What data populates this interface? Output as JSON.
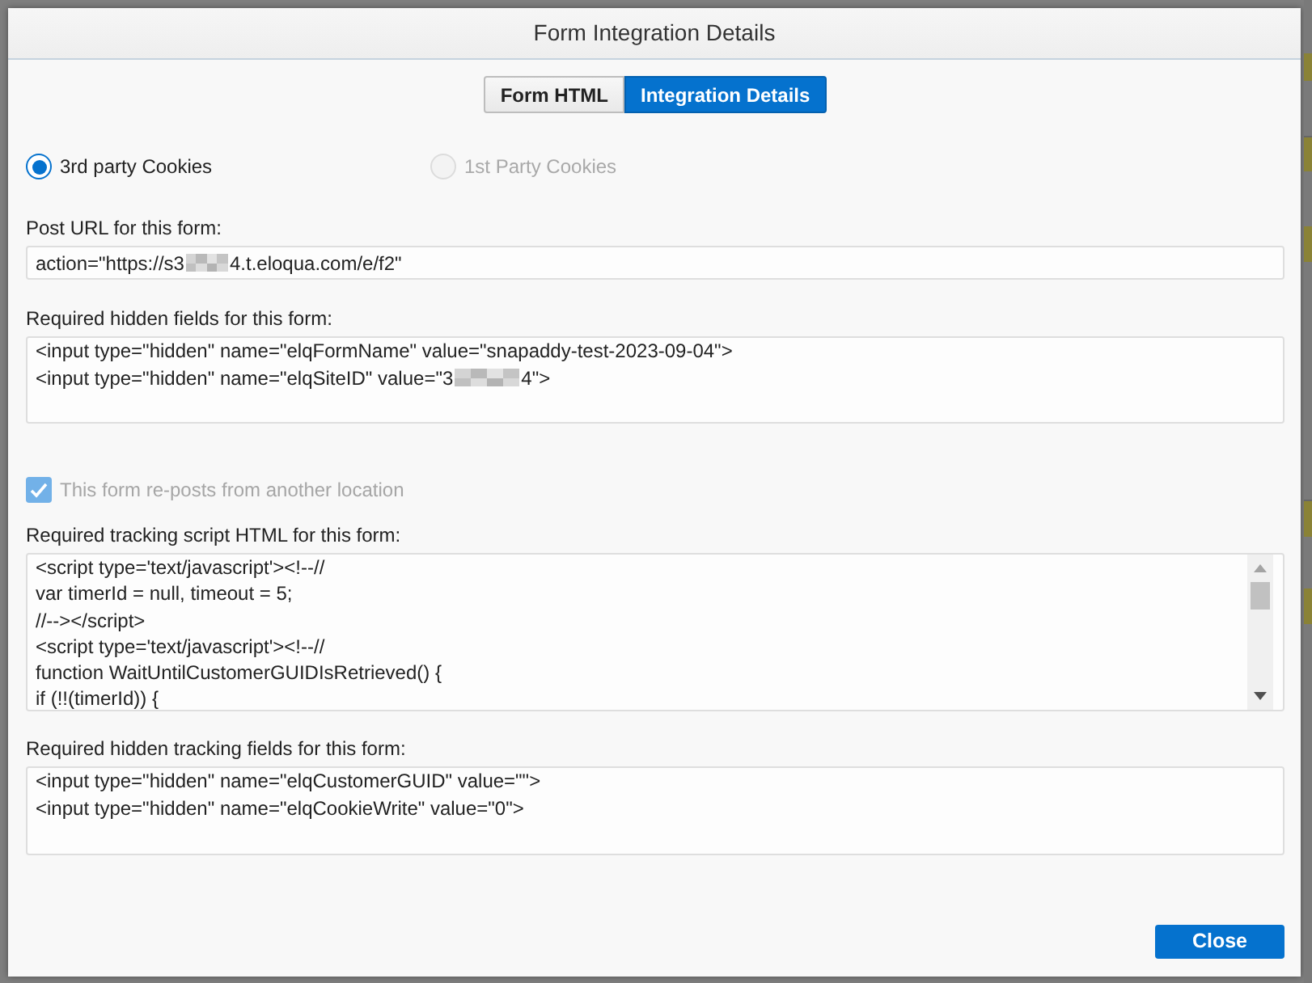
{
  "window": {
    "title": "Form Integration Details"
  },
  "tabs": [
    {
      "label": "Form HTML",
      "selected": false
    },
    {
      "label": "Integration Details",
      "selected": true
    }
  ],
  "cookie_options": [
    {
      "label": "3rd party Cookies",
      "selected": true,
      "disabled": false
    },
    {
      "label": "1st Party Cookies",
      "selected": false,
      "disabled": true
    }
  ],
  "post_url": {
    "label": "Post URL for this form:",
    "value": [
      {
        "kind": "text",
        "text": "action=\"https://s3"
      },
      {
        "kind": "redacted"
      },
      {
        "kind": "text",
        "text": "4.t.eloqua.com/e/f2\""
      }
    ]
  },
  "hidden_fields": {
    "label": "Required hidden fields for this form:",
    "lines": [
      [
        {
          "kind": "text",
          "text": "<input type=\"hidden\" name=\"elqFormName\" value=\"snapaddy-test-2023-09-04\">"
        }
      ],
      [
        {
          "kind": "text",
          "text": "<input type=\"hidden\" name=\"elqSiteID\" value=\"3"
        },
        {
          "kind": "redacted"
        },
        {
          "kind": "text",
          "text": "4\">"
        }
      ]
    ]
  },
  "repost_checkbox": {
    "label": "This form re-posts from another location",
    "checked": true,
    "disabled": true
  },
  "tracking_script": {
    "label": "Required tracking script HTML for this form:",
    "lines": [
      "<script type='text/javascript'><!--//",
      "var timerId = null, timeout = 5;",
      "//--></script>",
      "<script type='text/javascript'><!--//",
      "function WaitUntilCustomerGUIDIsRetrieved() {",
      "if (!!(timerId)) {"
    ]
  },
  "hidden_tracking_fields": {
    "label": "Required hidden tracking fields for this form:",
    "lines": [
      "<input type=\"hidden\" name=\"elqCustomerGUID\" value=\"\">",
      "<input type=\"hidden\" name=\"elqCookieWrite\" value=\"0\">"
    ]
  },
  "buttons": [
    {
      "label": "Close"
    }
  ]
}
